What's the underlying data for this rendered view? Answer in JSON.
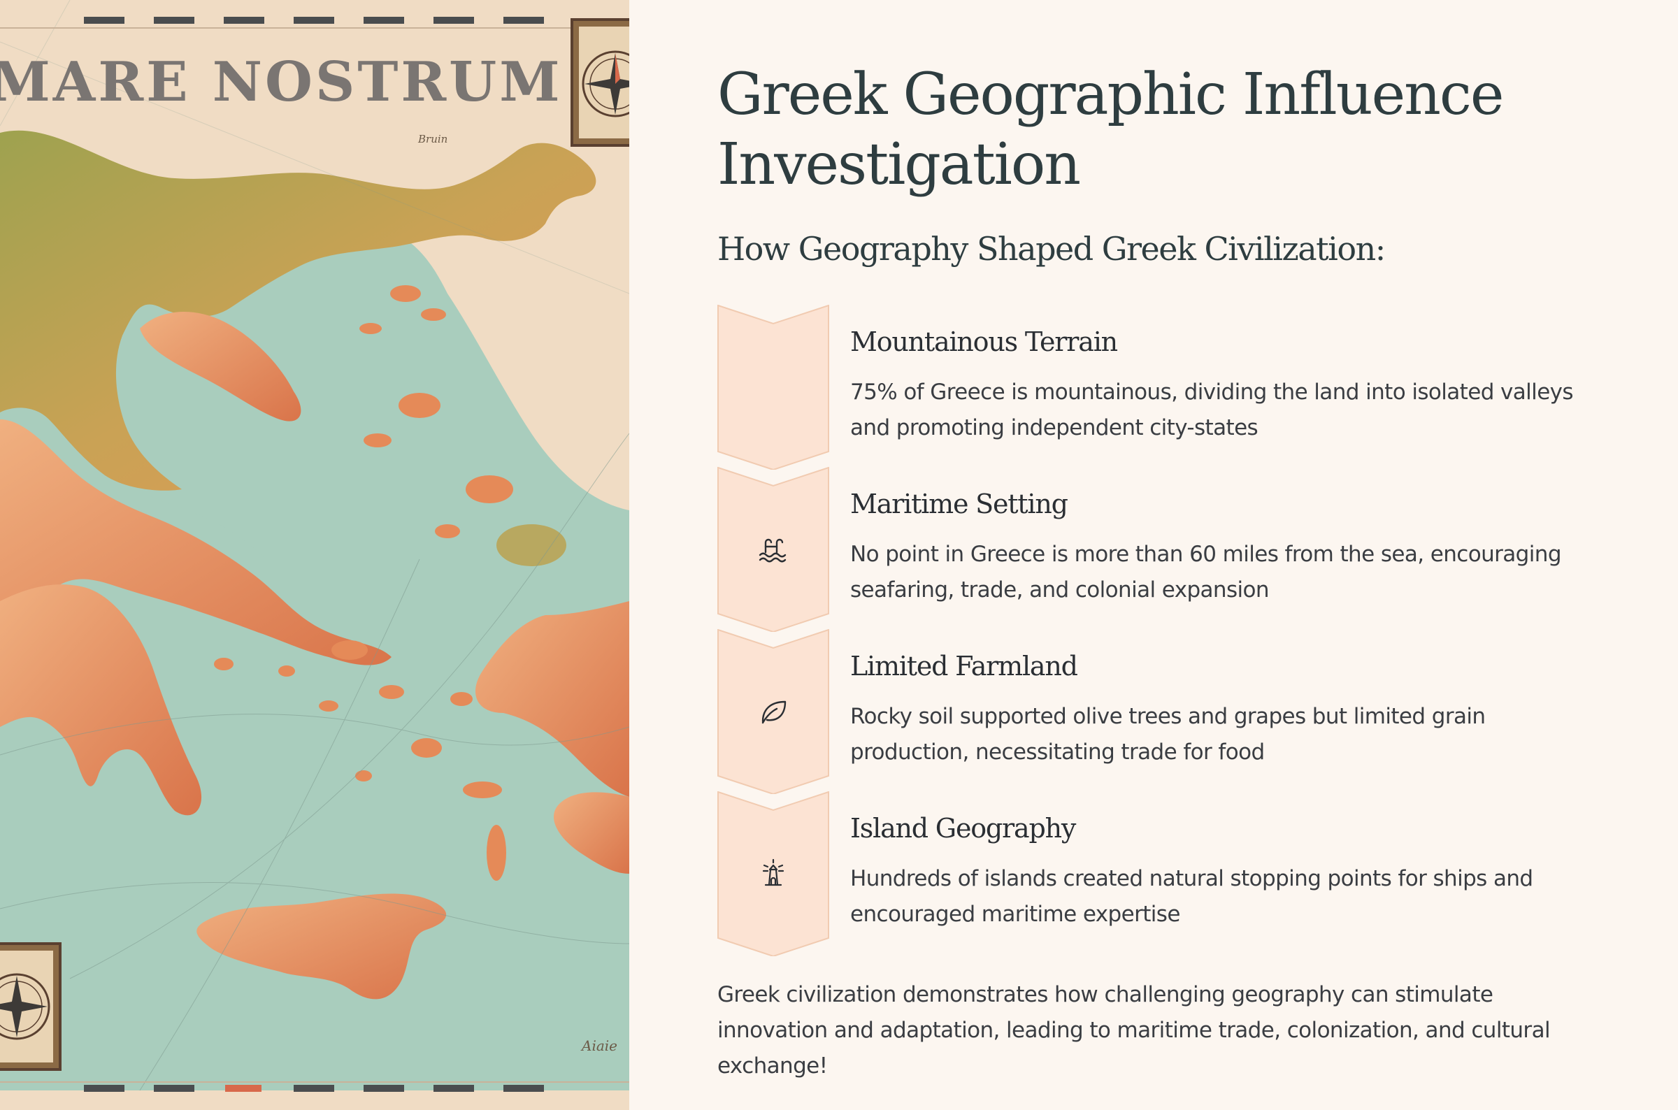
{
  "map": {
    "title": "MARE NOSTRUM",
    "labels": [
      "Bruin",
      "Aiaie"
    ]
  },
  "page": {
    "title": "Greek Geographic Influence Investigation",
    "subtitle": "How Geography Shaped Greek Civilization:"
  },
  "factors": [
    {
      "title": "Mountainous Terrain",
      "description": "75% of Greece is mountainous, dividing the land into isolated valleys and promoting independent city-states",
      "icon": "mountain-icon"
    },
    {
      "title": "Maritime Setting",
      "description": "No point in Greece is more than 60 miles from the sea, encouraging seafaring, trade, and colonial expansion",
      "icon": "pool-waves-icon"
    },
    {
      "title": "Limited Farmland",
      "description": "Rocky soil supported olive trees and grapes but limited grain production, necessitating trade for food",
      "icon": "leaf-icon"
    },
    {
      "title": "Island Geography",
      "description": "Hundreds of islands created natural stopping points for ships and encouraged maritime expertise",
      "icon": "lighthouse-icon"
    }
  ],
  "conclusion": "Greek civilization demonstrates how challenging geography can stimulate innovation and adaptation, leading to maritime trade, colonization, and cultural exchange!",
  "colors": {
    "background": "#fcf6f0",
    "chevron_fill": "#fce3d3",
    "chevron_stroke": "#f1cbb1",
    "heading": "#2e3d40",
    "sea": "#a9cdbd",
    "land_orange": "#e58a58",
    "land_green": "#a8a457",
    "parchment": "#f0dcc4"
  }
}
